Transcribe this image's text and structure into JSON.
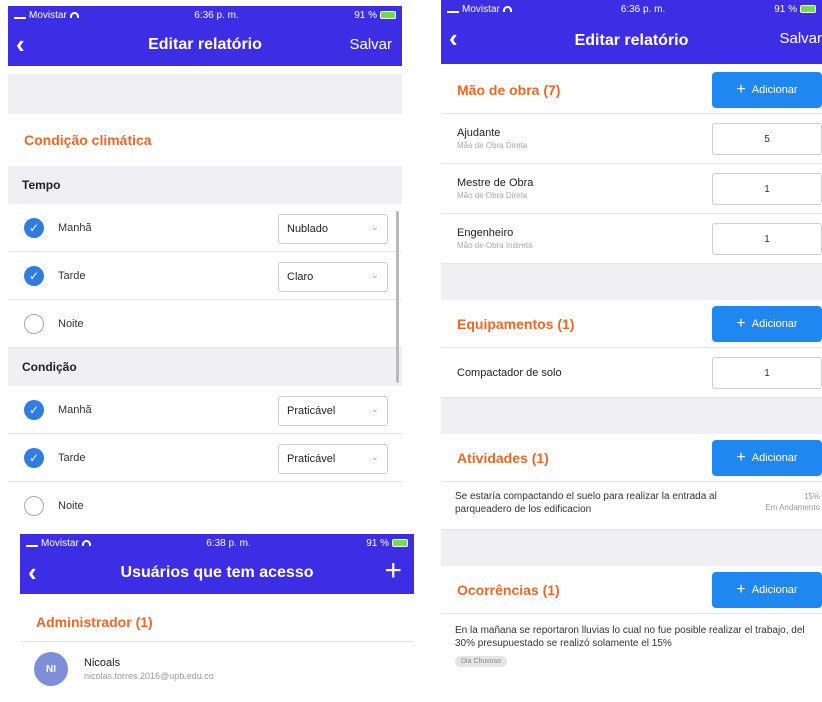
{
  "screen_a": {
    "status": {
      "carrier": "Movistar",
      "time": "6:36 p. m.",
      "battery": "91 %"
    },
    "nav": {
      "back_glyph": "‹",
      "title": "Editar relatório",
      "action": "Salvar"
    },
    "section_title": "Condição climática",
    "tempo": {
      "title": "Tempo",
      "rows": [
        {
          "label": "Manhã",
          "checked": true,
          "value": "Nublado"
        },
        {
          "label": "Tarde",
          "checked": true,
          "value": "Claro"
        },
        {
          "label": "Noite",
          "checked": false,
          "value": ""
        }
      ]
    },
    "condicao": {
      "title": "Condição",
      "rows": [
        {
          "label": "Manhã",
          "checked": true,
          "value": "Praticável"
        },
        {
          "label": "Tarde",
          "checked": true,
          "value": "Praticável"
        },
        {
          "label": "Noite",
          "checked": false,
          "value": ""
        }
      ]
    }
  },
  "screen_b": {
    "status": {
      "carrier": "Movistar",
      "time": "6:36 p. m.",
      "battery": "91 %"
    },
    "nav": {
      "back_glyph": "‹",
      "title": "Editar relatório",
      "action": "Salvar"
    },
    "add_label": "Adicionar",
    "mao_de_obra": {
      "title": "Mão de obra (7)",
      "items": [
        {
          "name": "Ajudante",
          "meta": "Mão de Obra Direta",
          "qty": "5"
        },
        {
          "name": "Mestre de Obra",
          "meta": "Mão de Obra Direta",
          "qty": "1"
        },
        {
          "name": "Engenheiro",
          "meta": "Mão de Obra Indireta",
          "qty": "1"
        }
      ]
    },
    "equipamentos": {
      "title": "Equipamentos (1)",
      "items": [
        {
          "name": "Compactador de solo",
          "qty": "1"
        }
      ]
    },
    "atividades": {
      "title": "Atividades (1)",
      "item": {
        "desc": "Se estaría compactando el suelo para realizar la entrada al parqueadero de los edificacion",
        "pct": "15%",
        "state": "Em Andamento"
      }
    },
    "ocorrencias": {
      "title": "Ocorrências (1)",
      "item": {
        "desc": "En la mañana se reportaron lluvias lo cual no fue posible realizar el trabajo, del 30% presupuestado se realizó solamente el 15%",
        "tag": "Dia Chuvoso"
      }
    }
  },
  "screen_c": {
    "status": {
      "carrier": "Movistar",
      "time": "6:38 p. m.",
      "battery": "91 %"
    },
    "nav": {
      "back_glyph": "‹",
      "title": "Usuários que tem acesso",
      "action_glyph": "+"
    },
    "section_title": "Administrador (1)",
    "user": {
      "initials": "NI",
      "name": "Nicoals",
      "email": "nicolas.torres.2016@upb.edu.co"
    }
  },
  "colors": {
    "brand": "#3d2ee6",
    "accent_orange": "#f26522",
    "button_blue": "#1e88f0",
    "check_blue": "#2f7de1",
    "avatar": "#7e8ed8"
  },
  "icons": {
    "check": "checkmark-icon",
    "chevron": "chevron-down-icon",
    "back": "back-arrow-icon",
    "plus": "plus-icon"
  }
}
